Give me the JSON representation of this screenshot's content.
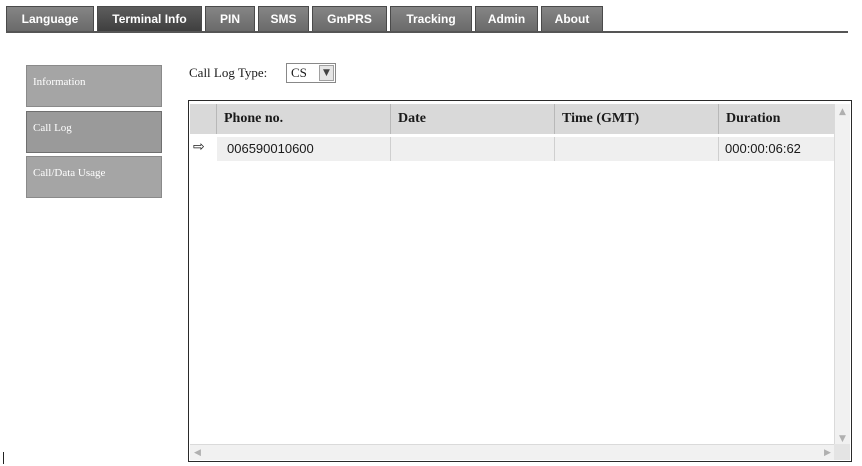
{
  "tabs": [
    {
      "label": "Language",
      "active": false
    },
    {
      "label": "Terminal Info",
      "active": true
    },
    {
      "label": "PIN",
      "active": false
    },
    {
      "label": "SMS",
      "active": false
    },
    {
      "label": "GmPRS",
      "active": false
    },
    {
      "label": "Tracking",
      "active": false
    },
    {
      "label": "Admin",
      "active": false
    },
    {
      "label": "About",
      "active": false
    }
  ],
  "sidebar": {
    "items": [
      {
        "label": "Information",
        "active": false
      },
      {
        "label": "Call Log",
        "active": true
      },
      {
        "label": "Call/Data Usage",
        "active": false
      }
    ]
  },
  "call_log_type": {
    "label": "Call Log Type:",
    "selected": "CS",
    "arrow_icon": "chevron-down-icon"
  },
  "table": {
    "columns": [
      "Phone no.",
      "Date",
      "Time (GMT)",
      "Duration"
    ],
    "rows": [
      {
        "icon": "outgoing-call-icon",
        "phone": "006590010600",
        "date": "",
        "time": "",
        "duration": "000:00:06:62"
      }
    ]
  },
  "scrollbars": {
    "up_icon": "scroll-up-icon",
    "down_icon": "scroll-down-icon",
    "left_icon": "scroll-left-icon",
    "right_icon": "scroll-right-icon"
  }
}
